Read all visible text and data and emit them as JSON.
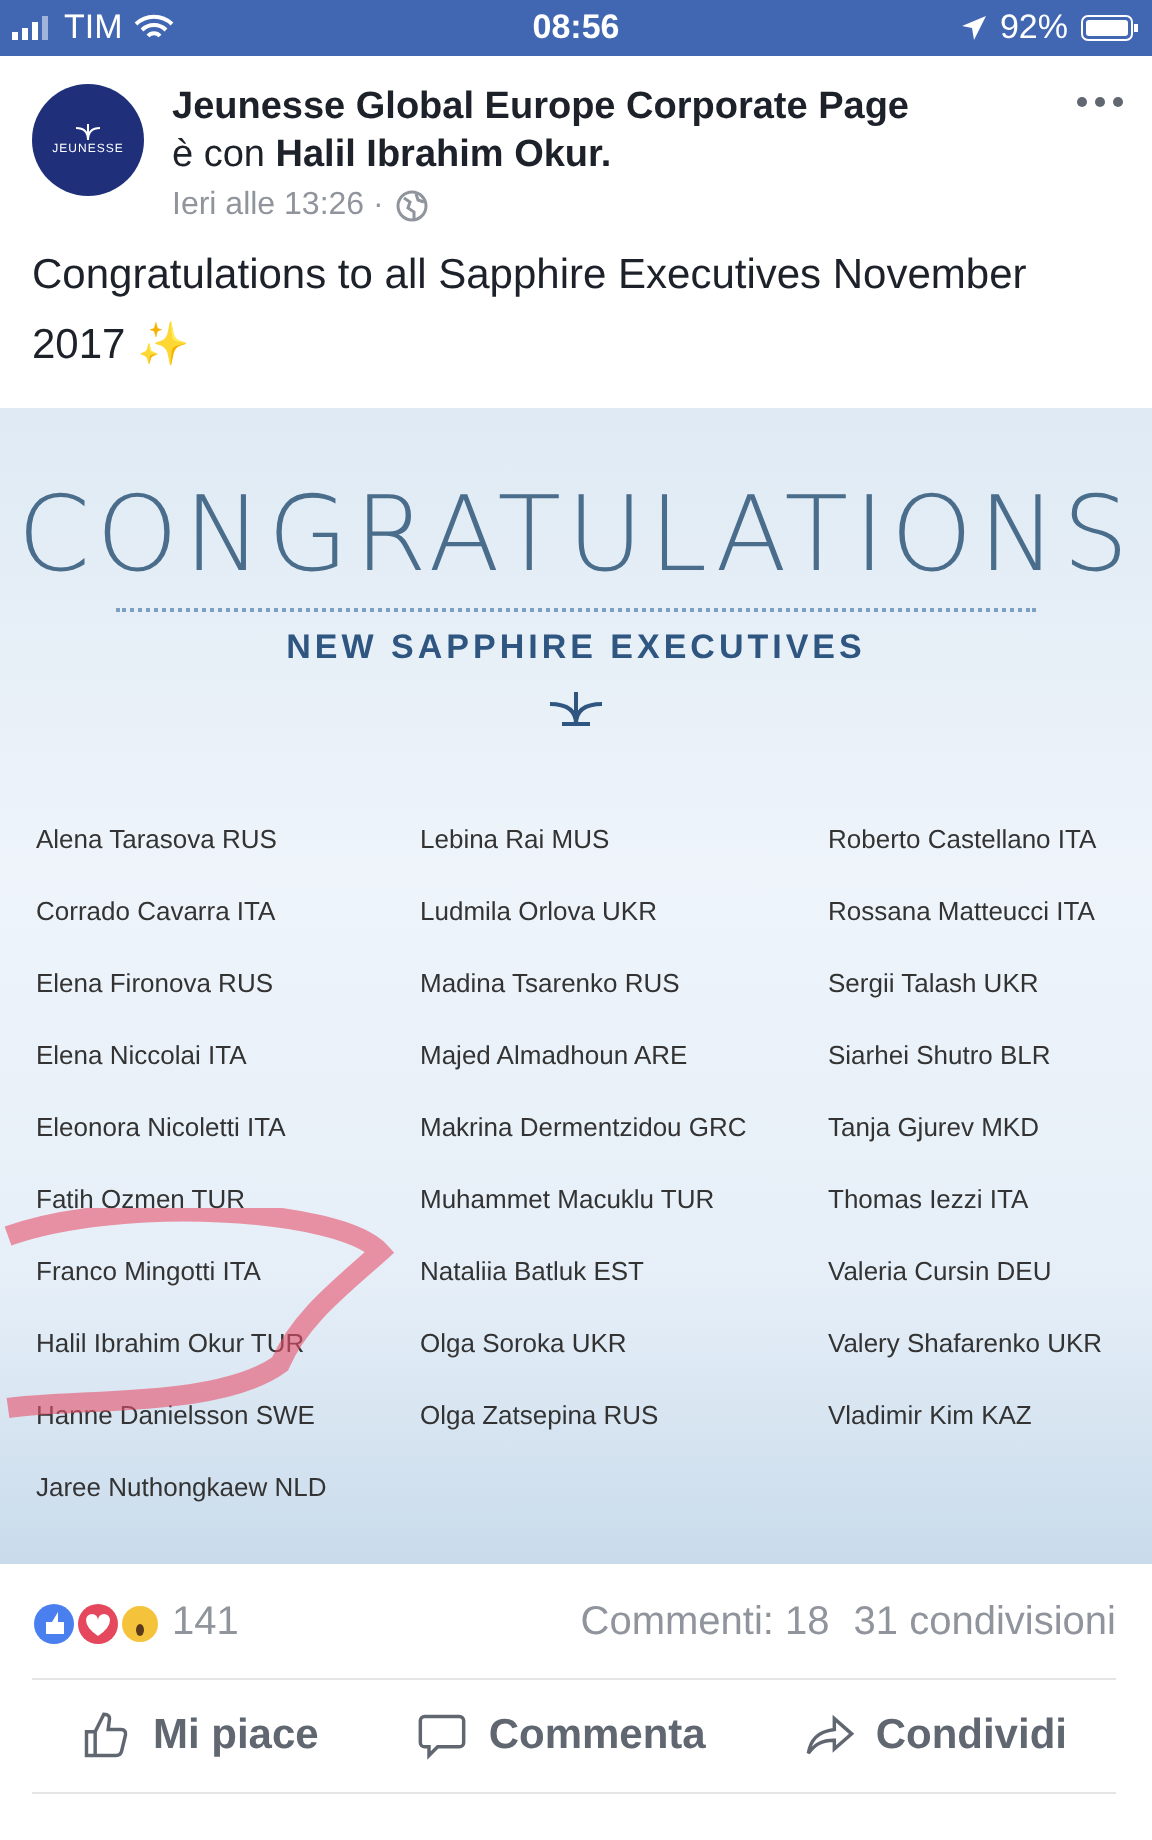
{
  "status_bar": {
    "carrier": "TIM",
    "time": "08:56",
    "battery": "92%"
  },
  "post": {
    "page_name": "Jeunesse Global Europe Corporate Page",
    "with_prefix": "è con",
    "with_name": "Halil Ibrahim Okur.",
    "avatar_text": "JEUNESSE",
    "timestamp": "Ieri alle 13:26 ·",
    "text": "Congratulations to all Sapphire Executives November 2017 ✨"
  },
  "graphic": {
    "title": "CONGRATULATIONS",
    "subtitle": "NEW SAPPHIRE EXECUTIVES",
    "columns": [
      [
        "Alena Tarasova RUS",
        "Corrado Cavarra ITA",
        "Elena Fironova RUS",
        "Elena Niccolai ITA",
        "Eleonora Nicoletti ITA",
        "Fatih Ozmen TUR",
        "Franco Mingotti ITA",
        "Halil Ibrahim Okur TUR",
        "Hanne Danielsson SWE",
        "Jaree Nuthongkaew NLD"
      ],
      [
        "Lebina Rai MUS",
        "Ludmila Orlova UKR",
        "Madina Tsarenko RUS",
        "Majed Almadhoun ARE",
        "Makrina Dermentzidou GRC",
        "Muhammet Macuklu TUR",
        "Nataliia Batluk EST",
        "Olga Soroka UKR",
        "Olga Zatsepina RUS"
      ],
      [
        "Roberto Castellano ITA",
        "Rossana Matteucci ITA",
        "Sergii Talash UKR",
        "Siarhei Shutro BLR",
        "Tanja Gjurev MKD",
        "Thomas Iezzi ITA",
        "Valeria Cursin DEU",
        "Valery Shafarenko UKR",
        "Vladimir Kim KAZ"
      ]
    ]
  },
  "stats": {
    "reactions": "141",
    "comments": "Commenti: 18",
    "shares": "31 condivisioni"
  },
  "actions": [
    {
      "kind": "like",
      "label": "Mi piace"
    },
    {
      "kind": "comment",
      "label": "Commenta"
    },
    {
      "kind": "share",
      "label": "Condividi"
    }
  ]
}
